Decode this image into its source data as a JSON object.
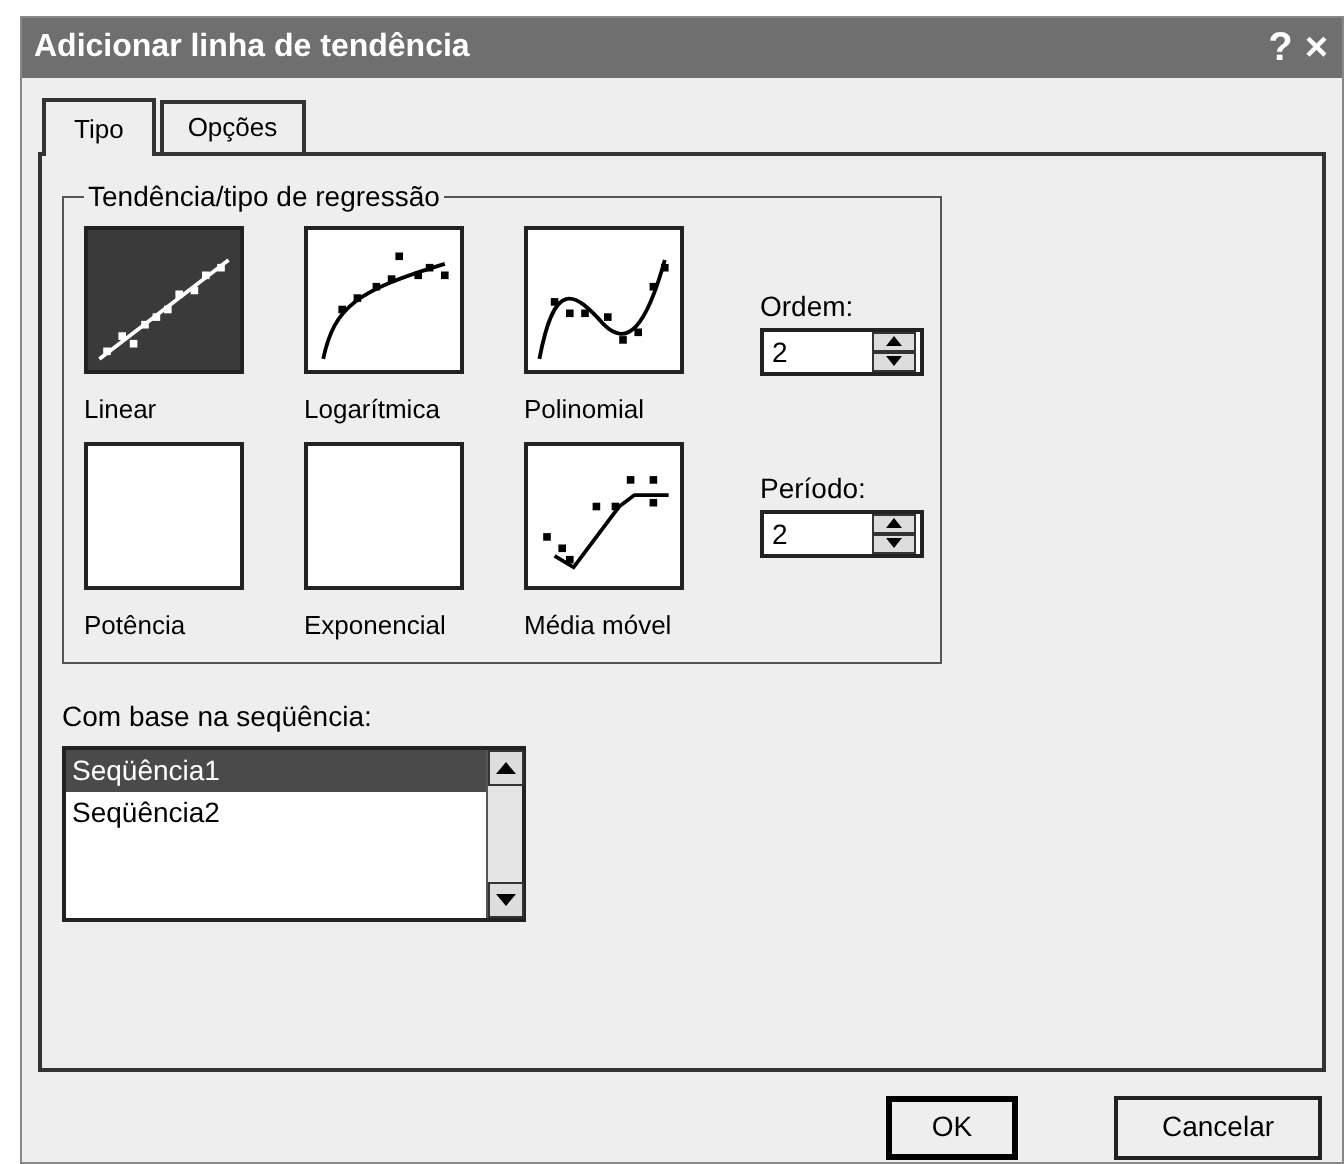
{
  "window": {
    "title": "Adicionar linha de tendência",
    "help_button": "?",
    "close_button": "×"
  },
  "tabs": [
    {
      "label": "Tipo",
      "selected": true
    },
    {
      "label": "Opções",
      "selected": false
    }
  ],
  "trend_group": {
    "title": "Tendência/tipo de regressão",
    "options": [
      {
        "label": "Linear",
        "kind": "linear",
        "selected": true
      },
      {
        "label": "Logarítmica",
        "kind": "logarithmic",
        "selected": false
      },
      {
        "label": "Polinomial",
        "kind": "polynomial",
        "selected": false
      },
      {
        "label": "Potência",
        "kind": "power",
        "selected": false
      },
      {
        "label": "Exponencial",
        "kind": "exponential",
        "selected": false
      },
      {
        "label": "Média móvel",
        "kind": "moving_average",
        "selected": false
      }
    ],
    "order": {
      "label": "Ordem:",
      "value": "2"
    },
    "period": {
      "label": "Período:",
      "value": "2"
    }
  },
  "series": {
    "label": "Com base na seqüência:",
    "items": [
      {
        "label": "Seqüência1",
        "selected": true
      },
      {
        "label": "Seqüência2",
        "selected": false
      }
    ]
  },
  "buttons": [
    {
      "label": "OK",
      "default": true
    },
    {
      "label": "Cancelar",
      "default": false
    }
  ]
}
